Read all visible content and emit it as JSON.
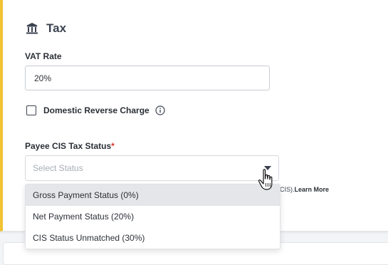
{
  "section": {
    "title": "Tax",
    "icon": "bank-icon"
  },
  "vat": {
    "label": "VAT Rate",
    "value": "20%"
  },
  "domestic_reverse_charge": {
    "label": "Domestic Reverse Charge",
    "checked": false,
    "icon": "info-icon"
  },
  "cis_status": {
    "label": "Payee CIS Tax Status",
    "required_mark": "*",
    "placeholder": "Select Status",
    "helper_text": "(CIS).",
    "helper_link": "Learn More",
    "options": [
      "Gross Payment Status (0%)",
      "Net Payment Status (20%)",
      "CIS Status Unmatched (30%)"
    ],
    "highlighted_index": 0
  },
  "colors": {
    "accent": "#f1c232",
    "required": "#d9322f",
    "highlight": "#e4e6e9"
  }
}
